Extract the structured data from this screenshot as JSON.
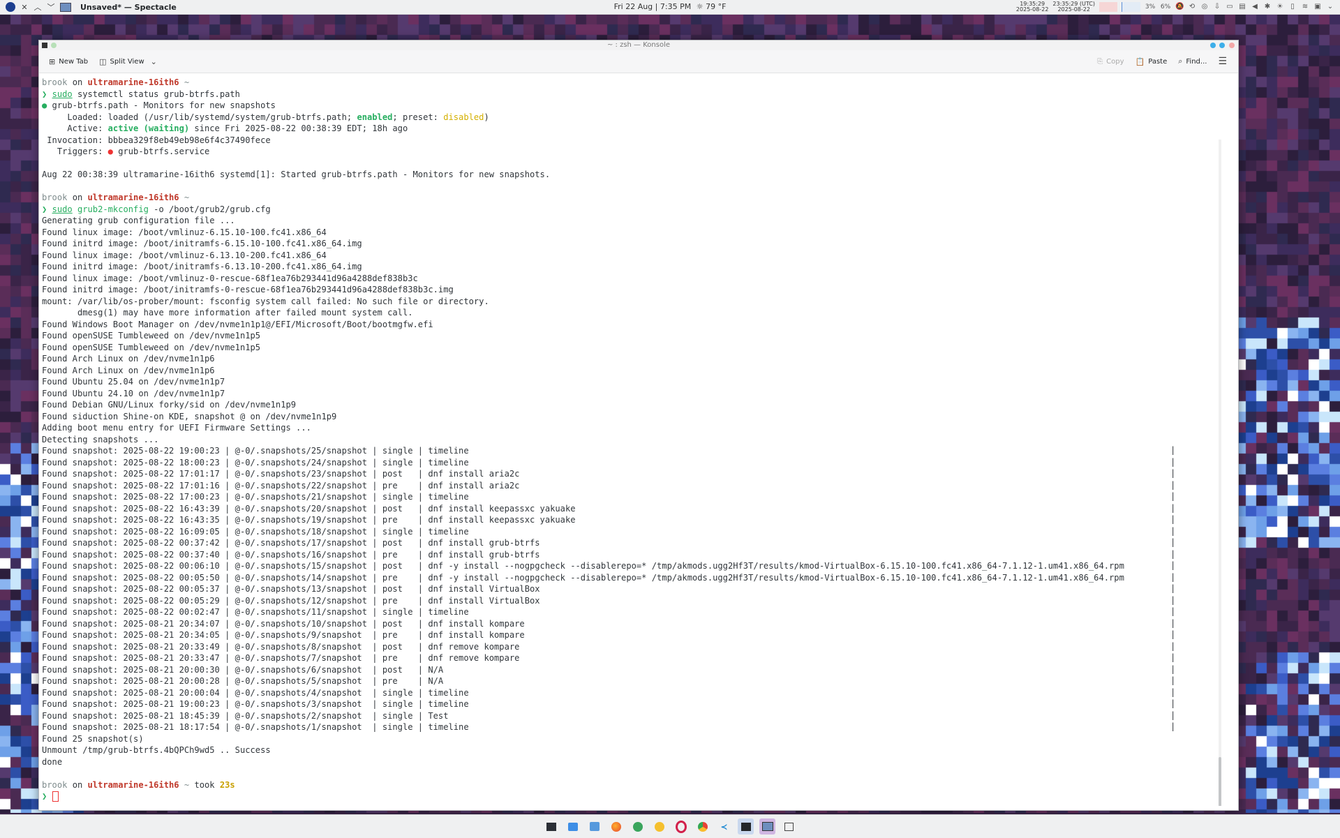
{
  "top_panel": {
    "app_title": "Unsaved* — Spectacle",
    "datetime": "Fri 22 Aug | 7:35 PM",
    "weather": "79 °F",
    "clocks": [
      {
        "time": "19:35:29",
        "date": "2025-08-22"
      },
      {
        "time": "23:35:29 (UTC)",
        "date": "2025-08-22"
      }
    ],
    "tray_percents": [
      "3%",
      "6%"
    ]
  },
  "window": {
    "title": "~ : zsh — Konsole",
    "toolbar": {
      "new_tab": "New Tab",
      "split_view": "Split View",
      "copy": "Copy",
      "paste": "Paste",
      "find": "Find..."
    }
  },
  "prompt": {
    "user": "brook",
    "on": "on",
    "host": "ultramarine-16ith6",
    "dir": "~",
    "took_label": "took",
    "took_value": "23s"
  },
  "terminal": {
    "cmd1_sudo": "sudo",
    "cmd1_rest": " systemctl status grub-btrfs.path",
    "status": [
      {
        "bullet": "●",
        "text": " grub-btrfs.path - Monitors for new snapshots"
      },
      {
        "pre": "     Loaded: loaded (/usr/lib/systemd/system/grub-btrfs.path; ",
        "enabled": "enabled",
        "mid": "; preset: ",
        "disabled": "disabled",
        "post": ")"
      },
      {
        "pre": "     Active: ",
        "active": "active (waiting)",
        "post": " since Fri 2025-08-22 00:38:39 EDT; 18h ago"
      },
      {
        "text": " Invocation: bbbea329f8eb49eb98e6f4c37490fece"
      },
      {
        "pre": "   Triggers: ",
        "bullet": "●",
        "post": " grub-btrfs.service"
      }
    ],
    "journal_line": "Aug 22 00:38:39 ultramarine-16ith6 systemd[1]: Started grub-btrfs.path - Monitors for new snapshots.",
    "cmd2_sudo": "sudo",
    "cmd2_prog": "grub2-mkconfig",
    "cmd2_args": " -o /boot/grub2/grub.cfg",
    "output": [
      "Generating grub configuration file ...",
      "Found linux image: /boot/vmlinuz-6.15.10-100.fc41.x86_64",
      "Found initrd image: /boot/initramfs-6.15.10-100.fc41.x86_64.img",
      "Found linux image: /boot/vmlinuz-6.13.10-200.fc41.x86_64",
      "Found initrd image: /boot/initramfs-6.13.10-200.fc41.x86_64.img",
      "Found linux image: /boot/vmlinuz-0-rescue-68f1ea76b293441d96a4288def838b3c",
      "Found initrd image: /boot/initramfs-0-rescue-68f1ea76b293441d96a4288def838b3c.img",
      "mount: /var/lib/os-prober/mount: fsconfig system call failed: No such file or directory.",
      "       dmesg(1) may have more information after failed mount system call.",
      "Found Windows Boot Manager on /dev/nvme1n1p1@/EFI/Microsoft/Boot/bootmgfw.efi",
      "Found openSUSE Tumbleweed on /dev/nvme1n1p5",
      "Found openSUSE Tumbleweed on /dev/nvme1n1p5",
      "Found Arch Linux on /dev/nvme1n1p6",
      "Found Arch Linux on /dev/nvme1n1p6",
      "Found Ubuntu 25.04 on /dev/nvme1n1p7",
      "Found Ubuntu 24.10 on /dev/nvme1n1p7",
      "Found Debian GNU/Linux forky/sid on /dev/nvme1n1p9",
      "Found siduction Shine-on KDE, snapshot @ on /dev/nvme1n1p9",
      "Adding boot menu entry for UEFI Firmware Settings ...",
      "Detecting snapshots ..."
    ],
    "snapshots": [
      "Found snapshot: 2025-08-22 19:00:23 | @-0/.snapshots/25/snapshot | single | timeline",
      "Found snapshot: 2025-08-22 18:00:23 | @-0/.snapshots/24/snapshot | single | timeline",
      "Found snapshot: 2025-08-22 17:01:17 | @-0/.snapshots/23/snapshot | post   | dnf install aria2c",
      "Found snapshot: 2025-08-22 17:01:16 | @-0/.snapshots/22/snapshot | pre    | dnf install aria2c",
      "Found snapshot: 2025-08-22 17:00:23 | @-0/.snapshots/21/snapshot | single | timeline",
      "Found snapshot: 2025-08-22 16:43:39 | @-0/.snapshots/20/snapshot | post   | dnf install keepassxc yakuake",
      "Found snapshot: 2025-08-22 16:43:35 | @-0/.snapshots/19/snapshot | pre    | dnf install keepassxc yakuake",
      "Found snapshot: 2025-08-22 16:09:05 | @-0/.snapshots/18/snapshot | single | timeline",
      "Found snapshot: 2025-08-22 00:37:42 | @-0/.snapshots/17/snapshot | post   | dnf install grub-btrfs",
      "Found snapshot: 2025-08-22 00:37:40 | @-0/.snapshots/16/snapshot | pre    | dnf install grub-btrfs",
      "Found snapshot: 2025-08-22 00:06:10 | @-0/.snapshots/15/snapshot | post   | dnf -y install --nogpgcheck --disablerepo=* /tmp/akmods.ugg2Hf3T/results/kmod-VirtualBox-6.15.10-100.fc41.x86_64-7.1.12-1.um41.x86_64.rpm",
      "Found snapshot: 2025-08-22 00:05:50 | @-0/.snapshots/14/snapshot | pre    | dnf -y install --nogpgcheck --disablerepo=* /tmp/akmods.ugg2Hf3T/results/kmod-VirtualBox-6.15.10-100.fc41.x86_64-7.1.12-1.um41.x86_64.rpm",
      "Found snapshot: 2025-08-22 00:05:37 | @-0/.snapshots/13/snapshot | post   | dnf install VirtualBox",
      "Found snapshot: 2025-08-22 00:05:29 | @-0/.snapshots/12/snapshot | pre    | dnf install VirtualBox",
      "Found snapshot: 2025-08-22 00:02:47 | @-0/.snapshots/11/snapshot | single | timeline",
      "Found snapshot: 2025-08-21 20:34:07 | @-0/.snapshots/10/snapshot | post   | dnf install kompare",
      "Found snapshot: 2025-08-21 20:34:05 | @-0/.snapshots/9/snapshot  | pre    | dnf install kompare",
      "Found snapshot: 2025-08-21 20:33:49 | @-0/.snapshots/8/snapshot  | post   | dnf remove kompare",
      "Found snapshot: 2025-08-21 20:33:47 | @-0/.snapshots/7/snapshot  | pre    | dnf remove kompare",
      "Found snapshot: 2025-08-21 20:00:30 | @-0/.snapshots/6/snapshot  | post   | N/A",
      "Found snapshot: 2025-08-21 20:00:28 | @-0/.snapshots/5/snapshot  | pre    | N/A",
      "Found snapshot: 2025-08-21 20:00:04 | @-0/.snapshots/4/snapshot  | single | timeline",
      "Found snapshot: 2025-08-21 19:00:23 | @-0/.snapshots/3/snapshot  | single | timeline",
      "Found snapshot: 2025-08-21 18:45:39 | @-0/.snapshots/2/snapshot  | single | Test",
      "Found snapshot: 2025-08-21 18:17:54 | @-0/.snapshots/1/snapshot  | single | timeline"
    ],
    "summary": [
      "Found 25 snapshot(s)",
      "Unmount /tmp/grub-btrfs.4bQPCh9wd5 .. Success",
      "done"
    ],
    "prompt_char": "❯"
  },
  "colors": {
    "prompt_host": "#c0392b",
    "prompt_arrow": "#27ae60",
    "enabled": "#27ae60",
    "disabled": "#d4b000"
  },
  "taskbar": {
    "icons": [
      "terminal-icon",
      "files-icon",
      "discover-icon",
      "firefox-icon",
      "chrome-canary-icon",
      "notes-icon",
      "opera-icon",
      "chrome-icon",
      "vscode-icon",
      "konsole-icon",
      "spectacle-icon",
      "desktop-icon"
    ]
  }
}
